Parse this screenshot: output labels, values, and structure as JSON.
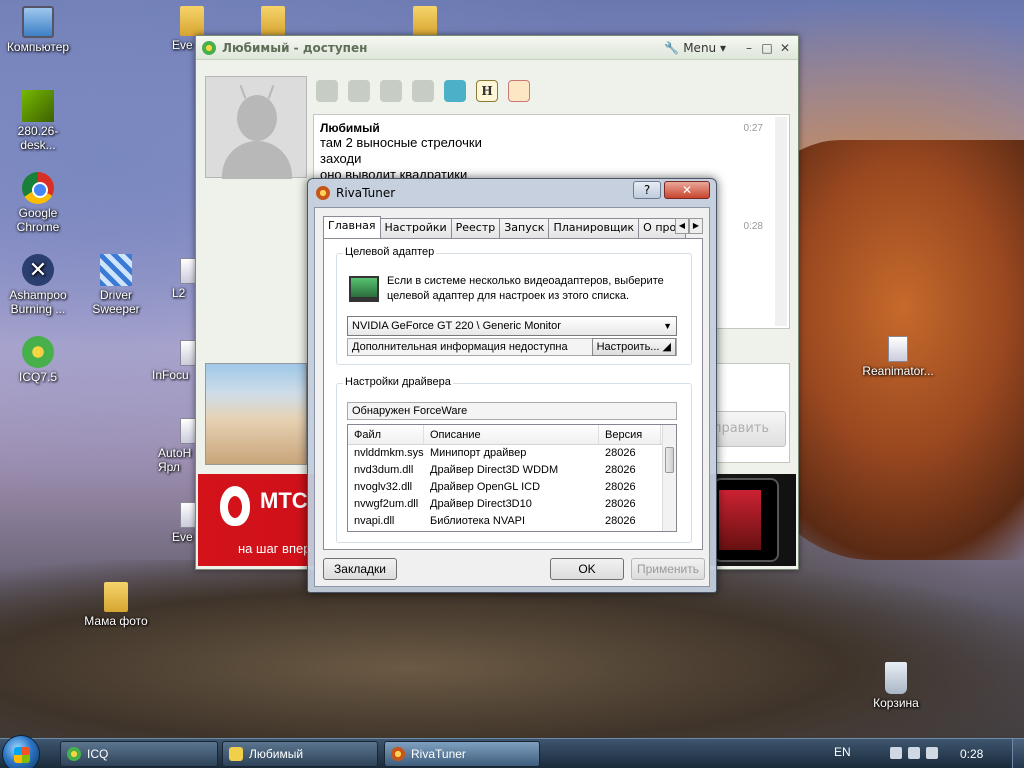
{
  "desktop": {
    "icons": [
      {
        "id": "computer",
        "label": "Компьютер",
        "icon": "computer-icon"
      },
      {
        "id": "nvidia",
        "label": "280.26-desk...",
        "icon": "nvidia-icon"
      },
      {
        "id": "chrome",
        "label": "Google Chrome",
        "icon": "chrome-icon"
      },
      {
        "id": "ashampoo",
        "label": "Ashampoo Burning ...",
        "icon": "ashampoo-icon"
      },
      {
        "id": "driver-sweeper",
        "label": "Driver Sweeper",
        "icon": "driver-sweeper-icon"
      },
      {
        "id": "icq75",
        "label": "ICQ7.5",
        "icon": "icq-icon"
      },
      {
        "id": "infocus",
        "label": "InFocu",
        "icon": "shortcut-icon"
      },
      {
        "id": "l2",
        "label": "L2",
        "icon": "shortcut-icon"
      },
      {
        "id": "autoh",
        "label": "AutoH Ярл",
        "icon": "shortcut-icon"
      },
      {
        "id": "eve1",
        "label": "Eve",
        "icon": "folder-icon"
      },
      {
        "id": "eve2",
        "label": "Eve",
        "icon": "shortcut-icon"
      },
      {
        "id": "mama-foto",
        "label": "Мама фото",
        "icon": "folder-icon"
      },
      {
        "id": "reanimator",
        "label": "Reanimator...",
        "icon": "reanimator-icon"
      },
      {
        "id": "korzina",
        "label": "Корзина",
        "icon": "recycle-bin-icon"
      }
    ]
  },
  "icq_window": {
    "title": "Любимый - доступен",
    "menu_label": "Menu",
    "chat": {
      "sender": "Любимый",
      "time1": "0:27",
      "time2": "0:28",
      "lines": [
        "там 2 выносные стрелочки",
        "заходи",
        "оно выводит квадратики"
      ]
    },
    "send_label": "править",
    "ad": {
      "brand": "МТС",
      "tagline": "на шаг впер"
    }
  },
  "rivatuner": {
    "title": "RivaTuner",
    "help": "?",
    "close": "✕",
    "tabs": [
      "Главная",
      "Настройки",
      "Реестр",
      "Запуск",
      "Планировщик",
      "О програ"
    ],
    "target_adapter": {
      "label": "Целевой адаптер",
      "description": "Если в системе несколько видеоадаптеров, выберите целевой адаптер для настроек из этого списка.",
      "selected": "NVIDIA GeForce GT 220 \\ Generic Monitor",
      "info": "Дополнительная информация недоступна",
      "configure": "Настроить..."
    },
    "driver_settings": {
      "label": "Настройки драйвера",
      "detected": "Обнаружен ForceWare",
      "columns": [
        "Файл",
        "Описание",
        "Версия"
      ],
      "rows": [
        {
          "file": "nvlddmkm.sys",
          "desc": "Минипорт драйвер",
          "ver": "28026"
        },
        {
          "file": "nvd3dum.dll",
          "desc": "Драйвер Direct3D WDDM",
          "ver": "28026"
        },
        {
          "file": "nvoglv32.dll",
          "desc": "Драйвер OpenGL ICD",
          "ver": "28026"
        },
        {
          "file": "nvwgf2um.dll",
          "desc": "Драйвер Direct3D10",
          "ver": "28026"
        },
        {
          "file": "nvapi.dll",
          "desc": "Библиотека NVAPI",
          "ver": "28026"
        }
      ]
    },
    "buttons": {
      "bookmarks": "Закладки",
      "ok": "OK",
      "apply": "Применить"
    }
  },
  "taskbar": {
    "items": [
      {
        "label": "ICQ",
        "icon": "icq-icon"
      },
      {
        "label": "Любимый",
        "icon": "chat-icon"
      },
      {
        "label": "RivaTuner",
        "icon": "rivatuner-icon"
      }
    ],
    "lang": "EN",
    "clock": "0:28"
  }
}
